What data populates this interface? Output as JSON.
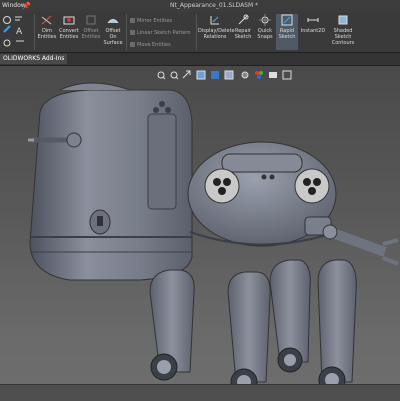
{
  "menu": {
    "window_label": "Window"
  },
  "document": {
    "title": "Nt_Appearance_01.SLDASM *"
  },
  "ribbon": {
    "dim_entities": "Dim Entities",
    "convert_entities": "Convert Entities",
    "offset_entities": "Offset Entities",
    "offset_on_surface": "Offset On Surface",
    "mirror_entities": "Mirror Entities",
    "linear_sketch_pattern": "Linear Sketch Pattern",
    "move_entities": "Move Entities",
    "display_delete_relations": "Display/Delete Relations",
    "repair_sketch": "Repair Sketch",
    "quick_snaps": "Quick Snaps",
    "rapid_sketch": "Rapid Sketch",
    "instant2d": "Instant2D",
    "shaded_sketch_contours": "Shaded Sketch Contours"
  },
  "tabs": {
    "addins": "OLIDWORKS Add-Ins"
  },
  "colors": {
    "ribbon_bg": "#3a3a3a",
    "viewport_top": "#4a4a4a",
    "model_body": "#7a7f8c"
  }
}
